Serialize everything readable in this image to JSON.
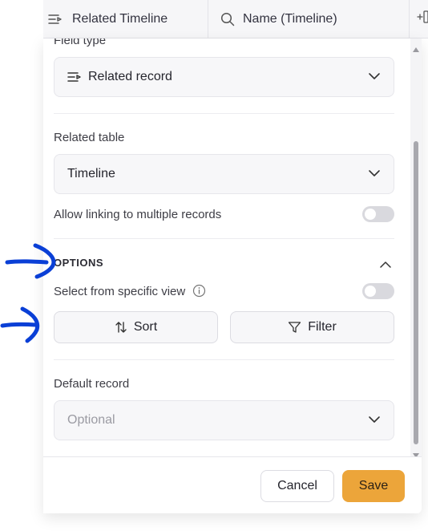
{
  "column_header": {
    "col1_label": "Related Timeline",
    "col1_icon": "related-record-icon",
    "col2_label": "Name (Timeline)",
    "col2_icon": "search-icon",
    "col3_icon": "add-column-icon"
  },
  "field_type": {
    "label": "Field type",
    "value": "Related record",
    "value_icon": "related-record-icon"
  },
  "related_table": {
    "label": "Related table",
    "value": "Timeline"
  },
  "allow_multiple": {
    "label": "Allow linking to multiple records",
    "enabled": false
  },
  "options": {
    "heading": "OPTIONS",
    "expanded": true,
    "specific_view_label": "Select from specific view",
    "specific_view_enabled": false,
    "sort_label": "Sort",
    "filter_label": "Filter"
  },
  "default_record": {
    "label": "Default record",
    "placeholder": "Optional"
  },
  "footer": {
    "cancel_label": "Cancel",
    "save_label": "Save"
  },
  "colors": {
    "accent": "#eca53a",
    "annotation": "#0a3fd6"
  }
}
